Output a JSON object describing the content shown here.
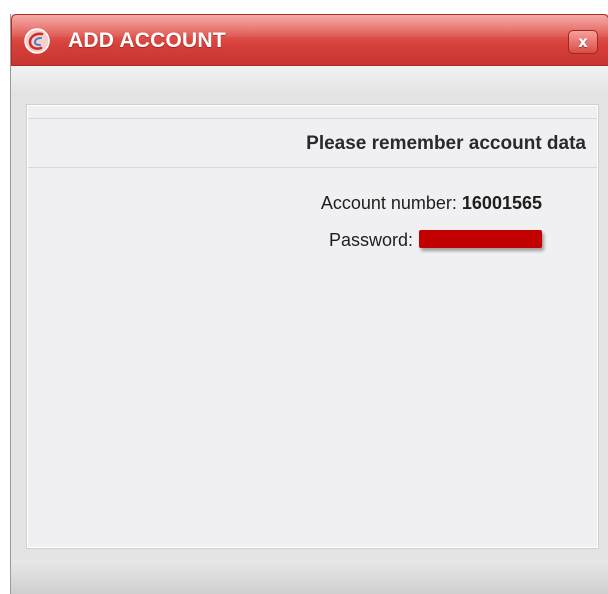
{
  "window": {
    "title": "ADD ACCOUNT",
    "close_label": "x",
    "accent_color": "#d6403a"
  },
  "panel": {
    "heading": "Please remember account data",
    "account_label": "Account number:",
    "account_value": "16001565",
    "password_label": "Password:",
    "password_value_state": "redacted"
  },
  "icons": {
    "logo": "app-logo-icon",
    "close": "close-icon"
  }
}
